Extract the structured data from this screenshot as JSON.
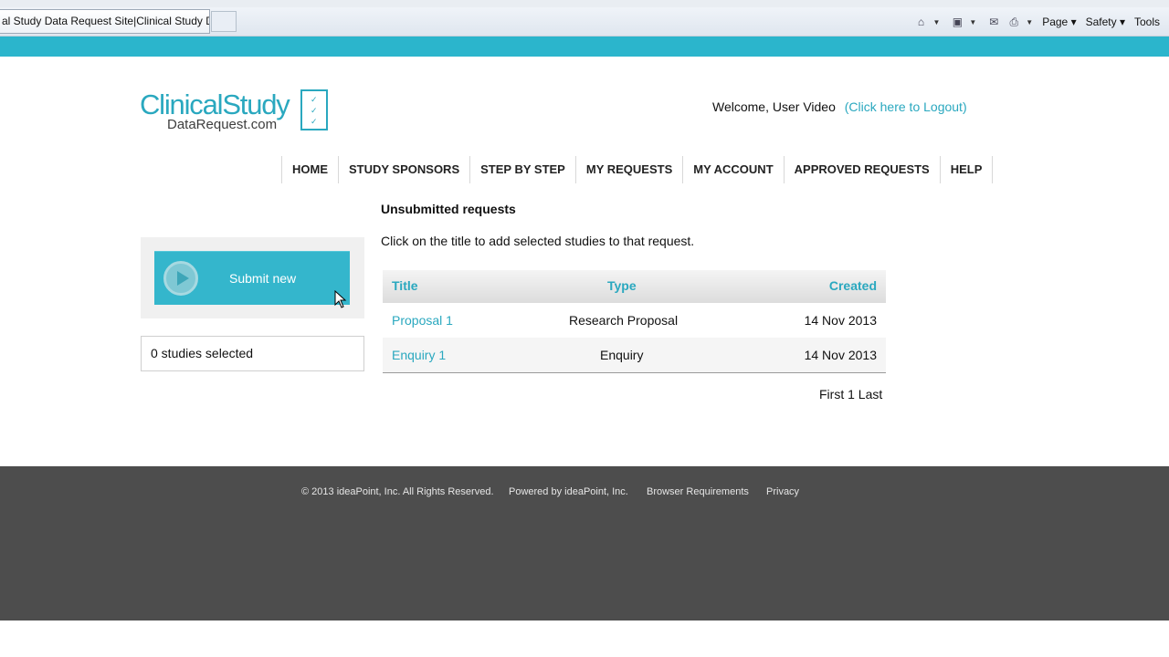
{
  "browser": {
    "tab_title": "al Study Data Request Site|Clinical Study Da...",
    "commands": [
      "Page",
      "Safety",
      "Tools"
    ]
  },
  "logo": {
    "main": "ClinicalStudy",
    "sub": "DataRequest.com"
  },
  "header": {
    "welcome": "Welcome, User Video",
    "logout": "(Click here to Logout)"
  },
  "nav": {
    "items": [
      "HOME",
      "STUDY SPONSORS",
      "STEP BY STEP",
      "MY REQUESTS",
      "MY ACCOUNT",
      "APPROVED REQUESTS",
      "HELP"
    ]
  },
  "sidebar": {
    "submit_label": "Submit new",
    "studies_selected": "0 studies selected"
  },
  "main": {
    "title": "Unsubmitted requests",
    "instruction": "Click on the title to add selected studies to that request.",
    "table": {
      "headers": [
        "Title",
        "Type",
        "Created"
      ],
      "rows": [
        [
          "Proposal 1",
          "Research Proposal",
          "14 Nov 2013"
        ],
        [
          "Enquiry 1",
          "Enquiry",
          "14 Nov 2013"
        ]
      ]
    },
    "pager": "First 1 Last"
  },
  "footer": {
    "copyright": "© 2013 ideaPoint, Inc. All Rights Reserved.",
    "powered": "Powered by ideaPoint, Inc.",
    "browser_req": "Browser Requirements",
    "privacy": "Privacy"
  },
  "colors": {
    "accent": "#2aa8bf",
    "band": "#2bb5cc",
    "footer": "#4d4d4d"
  }
}
